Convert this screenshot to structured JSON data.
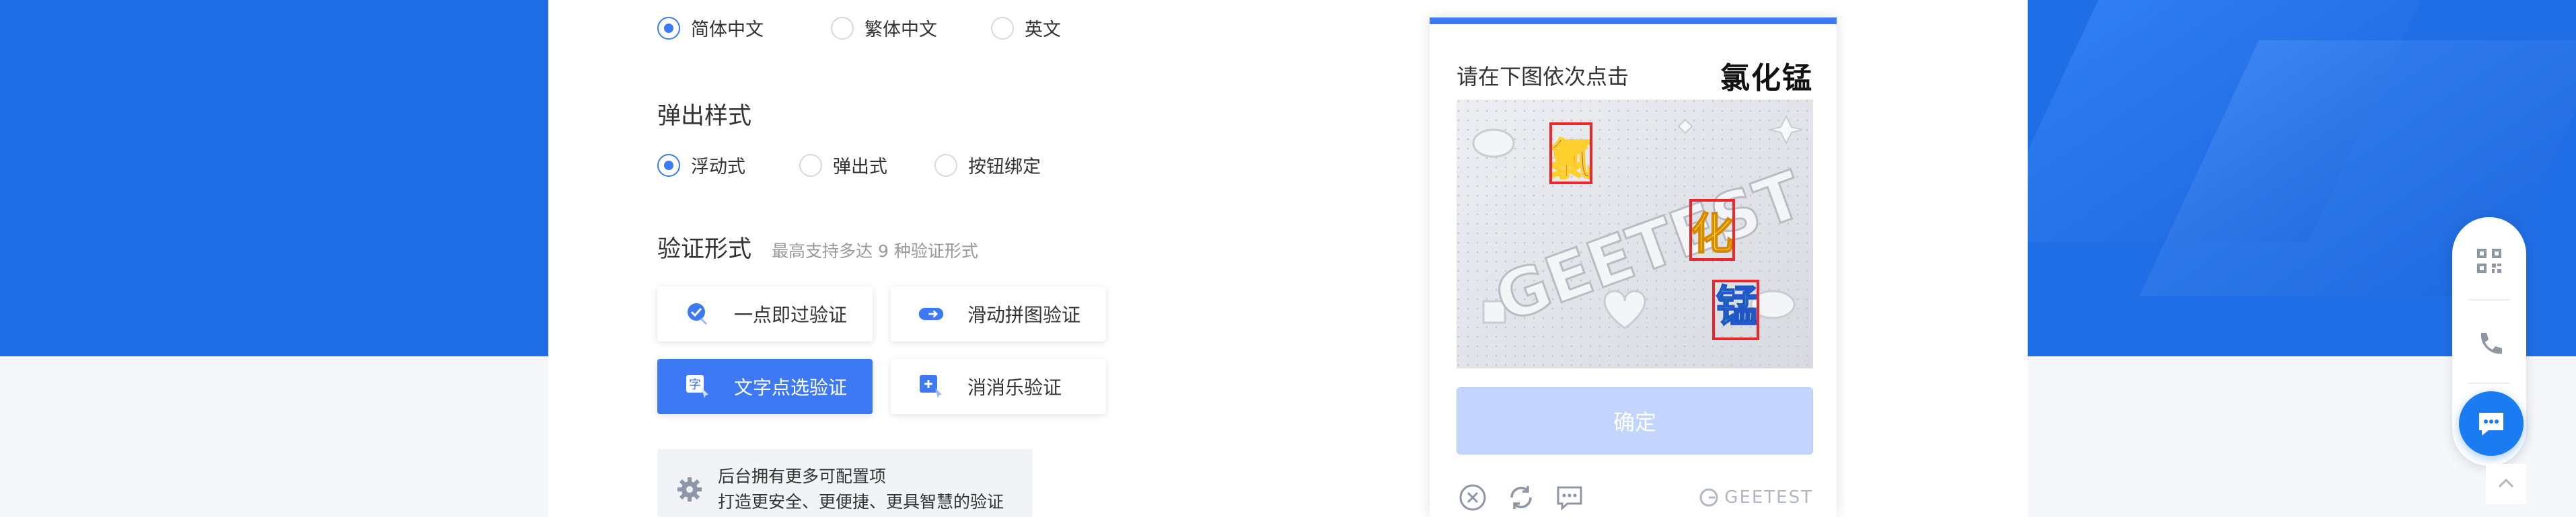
{
  "language": {
    "options": [
      {
        "label": "简体中文",
        "checked": true
      },
      {
        "label": "繁体中文",
        "checked": false
      },
      {
        "label": "英文",
        "checked": false
      }
    ]
  },
  "popup_style": {
    "title": "弹出样式",
    "options": [
      {
        "label": "浮动式",
        "checked": true
      },
      {
        "label": "弹出式",
        "checked": false
      },
      {
        "label": "按钮绑定",
        "checked": false
      }
    ]
  },
  "verify_form": {
    "title": "验证形式",
    "hint": "最高支持多达 9 种验证形式",
    "modes": [
      {
        "label": "一点即过验证",
        "icon": "one-click-check-icon",
        "active": false
      },
      {
        "label": "滑动拼图验证",
        "icon": "slide-puzzle-icon",
        "active": false
      },
      {
        "label": "文字点选验证",
        "icon": "text-click-icon",
        "active": true
      },
      {
        "label": "消消乐验证",
        "icon": "match-game-icon",
        "active": false
      }
    ]
  },
  "config_note": {
    "line1": "后台拥有更多可配置项",
    "line2": "打造更安全、更便捷、更具智慧的验证"
  },
  "captcha": {
    "instruction": "请在下图依次点击",
    "targets": "氯化锰",
    "confirm_label": "确定",
    "brand": "GEETEST",
    "image_text": "GEETEST",
    "accent": "#3d79f5",
    "marker_color": "#e8282b"
  },
  "colors": {
    "brand_blue": "#1f6ee6",
    "primary": "#3d79f5",
    "confirm_disabled": "#c3d5ff"
  }
}
